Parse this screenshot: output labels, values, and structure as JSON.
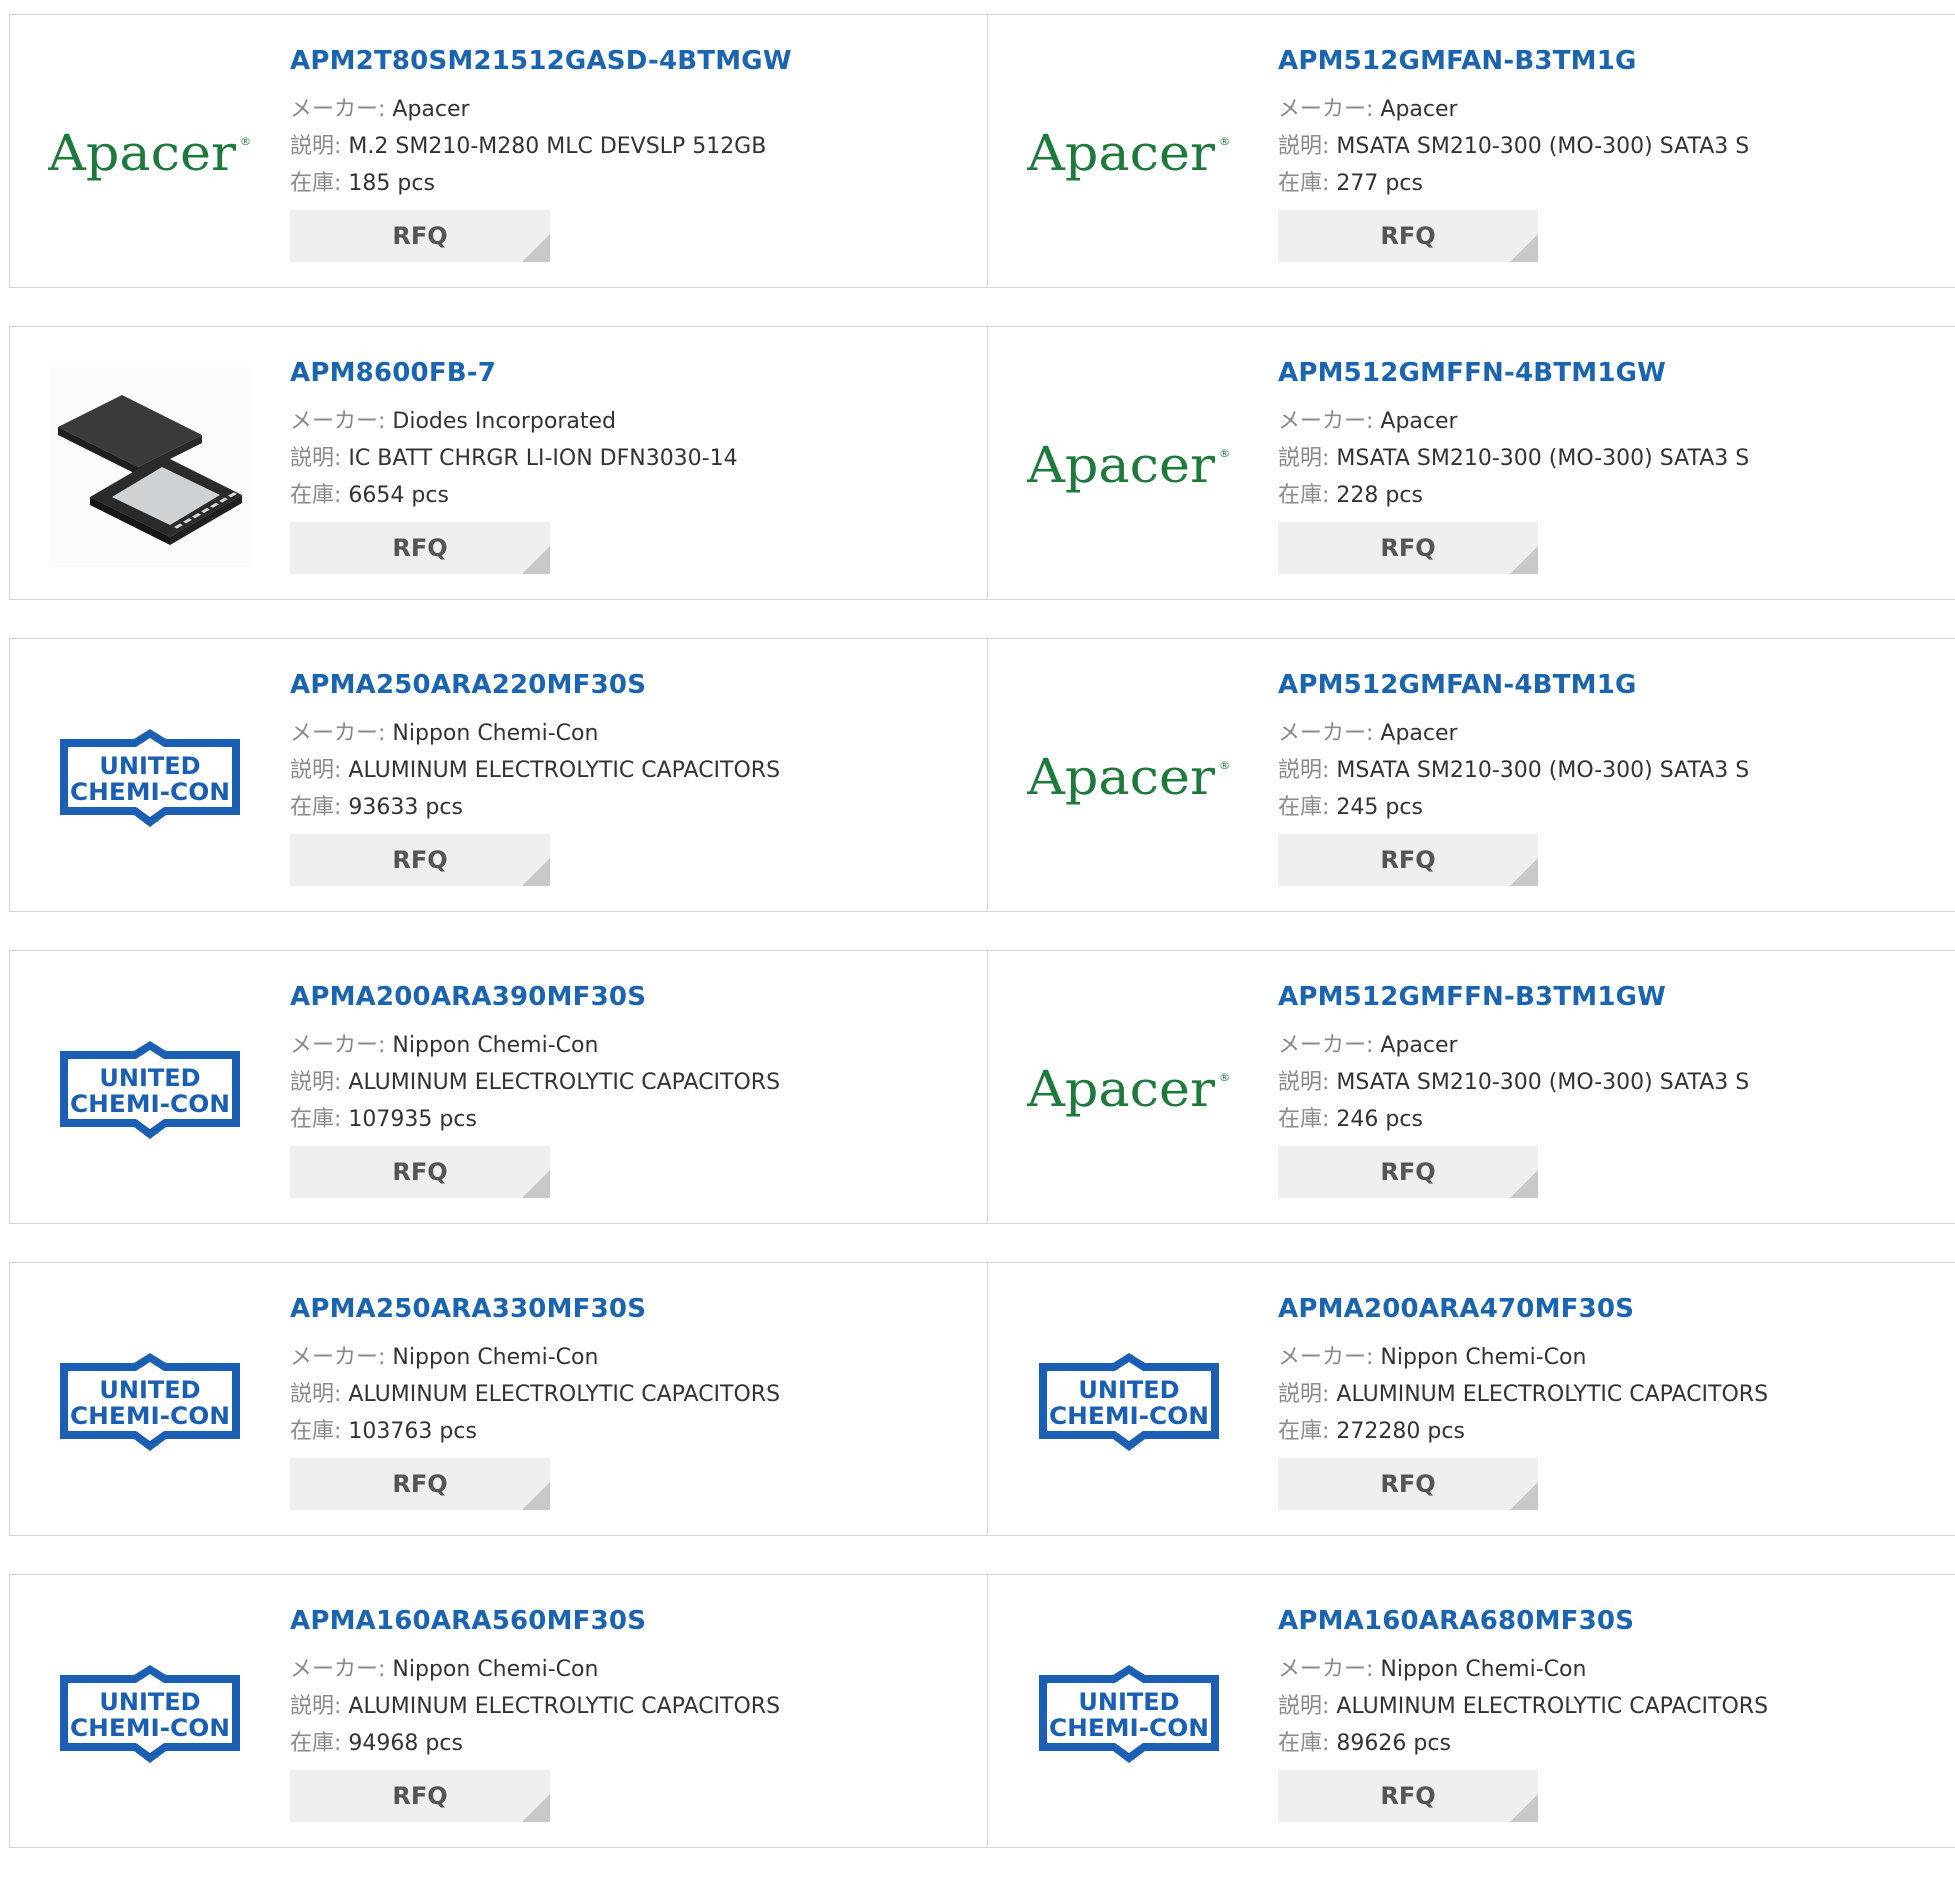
{
  "labels": {
    "maker": "メーカー:",
    "desc": "説明:",
    "stock": "在庫:",
    "rfq": "RFQ"
  },
  "brands": {
    "apacer": {
      "text": "Apacer",
      "reg": "®",
      "color": "#1e7a3c"
    },
    "ucc": {
      "line1": "UNITED",
      "line2": "CHEMI-CON",
      "color": "#1a5fb4"
    }
  },
  "rows": [
    [
      {
        "logo": "apacer-logo",
        "part": "APM2T80SM21512GASD-4BTMGW",
        "maker": "Apacer",
        "desc": "M.2 SM210-M280 MLC DEVSLP 512GB",
        "stock": "185 pcs"
      },
      {
        "logo": "apacer-logo",
        "part": "APM512GMFAN-B3TM1G",
        "maker": "Apacer",
        "desc": "MSATA SM210-300 (MO-300) SATA3 S",
        "stock": "277 pcs"
      }
    ],
    [
      {
        "logo": "chip-image",
        "part": "APM8600FB-7",
        "maker": "Diodes Incorporated",
        "desc": "IC BATT CHRGR LI-ION DFN3030-14",
        "stock": "6654 pcs"
      },
      {
        "logo": "apacer-logo",
        "part": "APM512GMFFN-4BTM1GW",
        "maker": "Apacer",
        "desc": "MSATA SM210-300 (MO-300) SATA3 S",
        "stock": "228 pcs"
      }
    ],
    [
      {
        "logo": "ucc-logo",
        "part": "APMA250ARA220MF30S",
        "maker": "Nippon Chemi-Con",
        "desc": "ALUMINUM ELECTROLYTIC CAPACITORS",
        "stock": "93633 pcs"
      },
      {
        "logo": "apacer-logo",
        "part": "APM512GMFAN-4BTM1G",
        "maker": "Apacer",
        "desc": "MSATA SM210-300 (MO-300) SATA3 S",
        "stock": "245 pcs"
      }
    ],
    [
      {
        "logo": "ucc-logo",
        "part": "APMA200ARA390MF30S",
        "maker": "Nippon Chemi-Con",
        "desc": "ALUMINUM ELECTROLYTIC CAPACITORS",
        "stock": "107935 pcs"
      },
      {
        "logo": "apacer-logo",
        "part": "APM512GMFFN-B3TM1GW",
        "maker": "Apacer",
        "desc": "MSATA SM210-300 (MO-300) SATA3 S",
        "stock": "246 pcs"
      }
    ],
    [
      {
        "logo": "ucc-logo",
        "part": "APMA250ARA330MF30S",
        "maker": "Nippon Chemi-Con",
        "desc": "ALUMINUM ELECTROLYTIC CAPACITORS",
        "stock": "103763 pcs"
      },
      {
        "logo": "ucc-logo",
        "part": "APMA200ARA470MF30S",
        "maker": "Nippon Chemi-Con",
        "desc": "ALUMINUM ELECTROLYTIC CAPACITORS",
        "stock": "272280 pcs"
      }
    ],
    [
      {
        "logo": "ucc-logo",
        "part": "APMA160ARA560MF30S",
        "maker": "Nippon Chemi-Con",
        "desc": "ALUMINUM ELECTROLYTIC CAPACITORS",
        "stock": "94968 pcs"
      },
      {
        "logo": "ucc-logo",
        "part": "APMA160ARA680MF30S",
        "maker": "Nippon Chemi-Con",
        "desc": "ALUMINUM ELECTROLYTIC CAPACITORS",
        "stock": "89626 pcs"
      }
    ]
  ]
}
